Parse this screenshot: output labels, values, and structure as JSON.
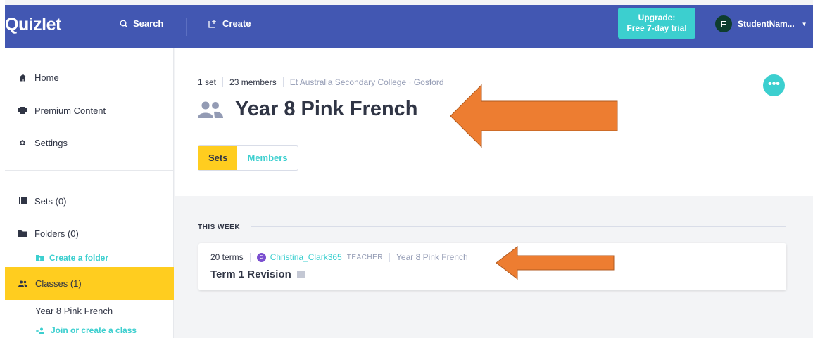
{
  "header": {
    "logo": "Quizlet",
    "search_label": "Search",
    "create_label": "Create",
    "upgrade_line1": "Upgrade:",
    "upgrade_line2": "Free 7-day trial",
    "avatar_letter": "E",
    "username": "StudentNam..."
  },
  "sidebar": {
    "home": "Home",
    "premium": "Premium Content",
    "settings": "Settings",
    "sets": "Sets (0)",
    "folders": "Folders (0)",
    "create_folder": "Create a folder",
    "classes": "Classes (1)",
    "class_item": "Year 8 Pink French",
    "join_class": "Join or create a class"
  },
  "class_page": {
    "set_count": "1 set",
    "member_count": "23 members",
    "school": "Et Australia Secondary College · Gosford",
    "title": "Year 8 Pink French",
    "more_label": "•••",
    "tabs": [
      {
        "label": "Sets",
        "active": true
      },
      {
        "label": "Members",
        "active": false
      }
    ]
  },
  "feed": {
    "section_label": "THIS WEEK",
    "set": {
      "terms": "20 terms",
      "creator_initial": "C",
      "creator": "Christina_Clark365",
      "role": "TEACHER",
      "class_name": "Year 8 Pink French",
      "title": "Term 1 Revision"
    }
  },
  "colors": {
    "header_bg": "#4257b2",
    "accent_teal": "#3ccfcf",
    "active_yellow": "#ffcd1f",
    "annotation_arrow": "#ed7d31"
  },
  "icons": {
    "search": "search-icon",
    "create": "create-icon",
    "home": "home-icon",
    "premium": "premium-icon",
    "settings": "gear-icon",
    "sets": "sets-icon",
    "folders": "folder-icon",
    "classes": "class-icon",
    "title": "group-icon",
    "image": "image-icon"
  }
}
